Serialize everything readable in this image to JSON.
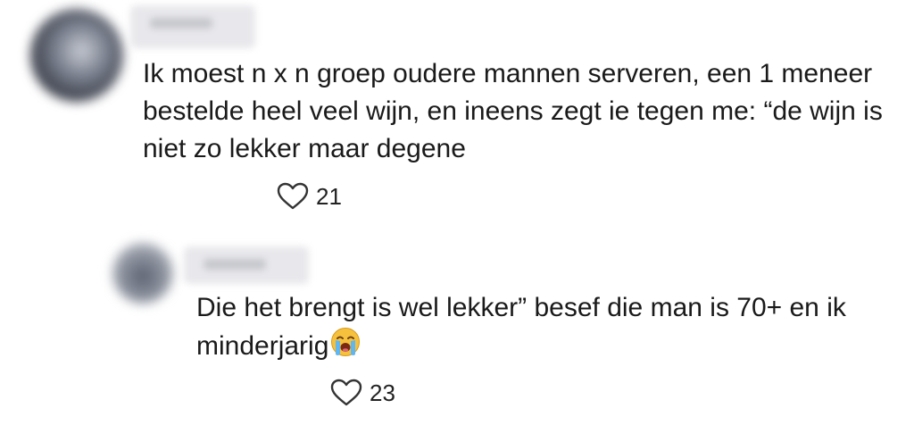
{
  "comments": [
    {
      "text": "Ik moest n x n groep oudere mannen serveren, een 1 meneer bestelde heel veel wijn, en ineens zegt ie tegen me: “de wijn is niet zo lekker maar degene",
      "likes": "21"
    },
    {
      "text": "Die het brengt is wel lekker” besef die man is 70+ en ik minderjarig",
      "emoji": "loudly-crying-face-icon",
      "likes": "23"
    }
  ],
  "icons": {
    "like": "heart-outline-icon"
  },
  "colors": {
    "text": "#1a1a1a",
    "heart_stroke": "#333333",
    "background": "#ffffff"
  }
}
